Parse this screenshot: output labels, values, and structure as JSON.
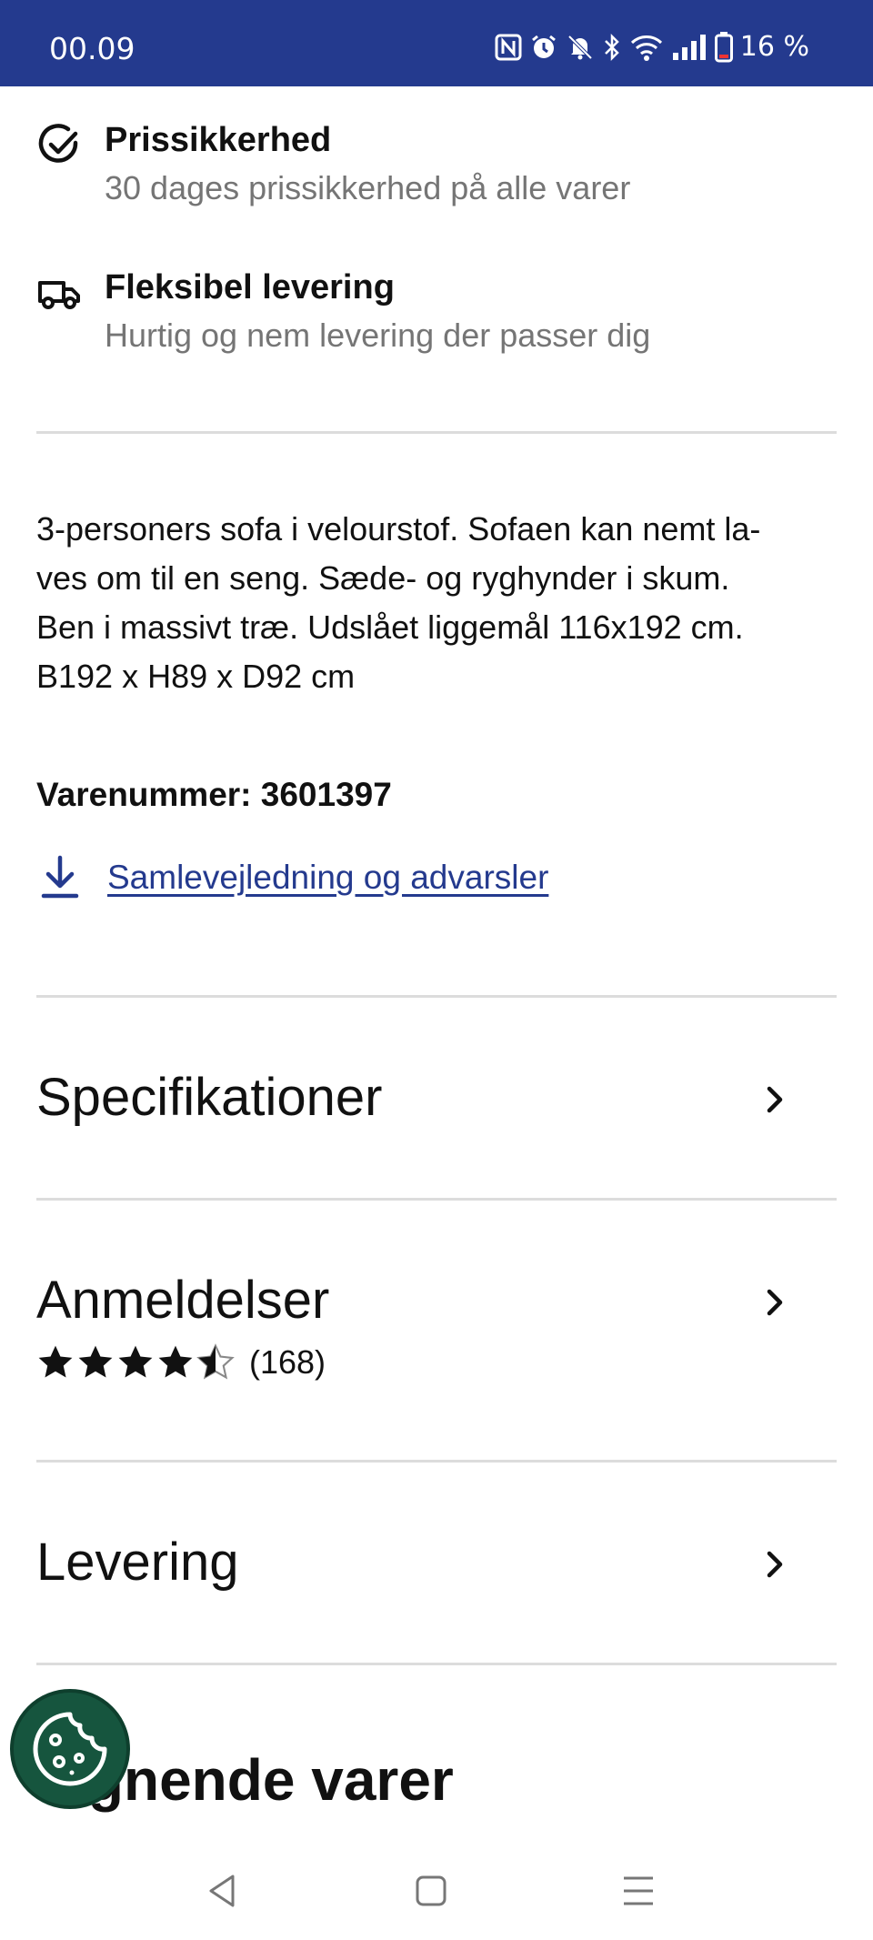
{
  "status_bar": {
    "time": "00.09",
    "battery": "16 %",
    "background": "#243a8e"
  },
  "usps": [
    {
      "icon": "check-circle-icon",
      "title": "Prissikkerhed",
      "subtitle": "30 dages prissikkerhed på alle varer"
    },
    {
      "icon": "truck-icon",
      "title": "Fleksibel levering",
      "subtitle": "Hurtig og nem levering der passer dig"
    }
  ],
  "product": {
    "description_lines": [
      "3-personers sofa i velourstof. Sofaen kan nemt la-",
      "ves om til en seng. Sæde- og ryghynder i skum.",
      "Ben i massivt træ. Udslået liggemål 116x192 cm.",
      "B192 x H89 x D92 cm"
    ],
    "article_label": "Varenummer:",
    "article_number": "3601397",
    "download_label": "Samlevejledning og advarsler"
  },
  "sections": {
    "specifications": "Specifikationer",
    "reviews": "Anmeldelser",
    "review_rating": 4.5,
    "review_count": "(168)",
    "delivery": "Levering"
  },
  "related": {
    "title": "Lignende varer"
  },
  "colors": {
    "brand_blue": "#243a8e",
    "cookie_green": "#16553e",
    "muted_text": "#757575"
  }
}
